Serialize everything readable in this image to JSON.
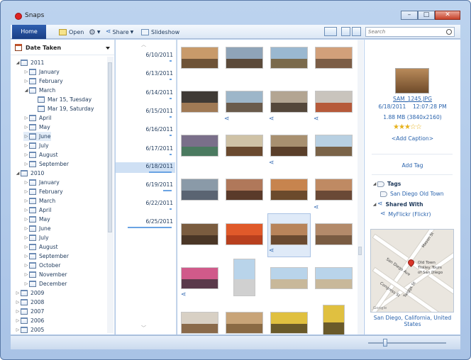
{
  "window": {
    "title": "Snaps"
  },
  "toolbar": {
    "home_tab": "Home",
    "open_label": "Open",
    "share_label": "Share",
    "slideshow_label": "Slideshow",
    "search_placeholder": "Search"
  },
  "sidebar": {
    "header": "Date Taken",
    "items": [
      {
        "label": "2011",
        "level": 0,
        "expanded": true
      },
      {
        "label": "January",
        "level": 1
      },
      {
        "label": "February",
        "level": 1
      },
      {
        "label": "March",
        "level": 1,
        "expanded": true
      },
      {
        "label": "Mar 15, Tuesday",
        "level": 2
      },
      {
        "label": "Mar 19, Saturday",
        "level": 2
      },
      {
        "label": "April",
        "level": 1
      },
      {
        "label": "May",
        "level": 1
      },
      {
        "label": "June",
        "level": 1,
        "selected": true
      },
      {
        "label": "July",
        "level": 1
      },
      {
        "label": "August",
        "level": 1
      },
      {
        "label": "September",
        "level": 1
      },
      {
        "label": "2010",
        "level": 0,
        "expanded": true
      },
      {
        "label": "January",
        "level": 1
      },
      {
        "label": "February",
        "level": 1
      },
      {
        "label": "March",
        "level": 1
      },
      {
        "label": "April",
        "level": 1
      },
      {
        "label": "May",
        "level": 1
      },
      {
        "label": "June",
        "level": 1
      },
      {
        "label": "July",
        "level": 1
      },
      {
        "label": "August",
        "level": 1
      },
      {
        "label": "September",
        "level": 1
      },
      {
        "label": "October",
        "level": 1
      },
      {
        "label": "November",
        "level": 1
      },
      {
        "label": "December",
        "level": 1
      },
      {
        "label": "2009",
        "level": 0
      },
      {
        "label": "2008",
        "level": 0
      },
      {
        "label": "2007",
        "level": 0
      },
      {
        "label": "2006",
        "level": 0
      },
      {
        "label": "2005",
        "level": 0
      }
    ]
  },
  "timeline": {
    "dates": [
      "6/10/2011",
      "6/13/2011",
      "6/14/2011",
      "6/15/2011",
      "6/16/2011",
      "6/17/2011",
      "6/18/2011",
      "6/19/2011",
      "6/22/2011",
      "6/25/2011"
    ],
    "selected": "6/18/2011"
  },
  "details": {
    "filename": "SAM_1245.JPG",
    "date": "6/18/2011",
    "time": "12:07:28 PM",
    "size": "1.88 MB (3840x2160)",
    "rating": 3,
    "rating_max": 5,
    "add_caption": "<Add Caption>",
    "add_tag": "Add Tag",
    "tags_header": "Tags",
    "tag_value": "San Diego Old Town",
    "shared_header": "Shared With",
    "shared_value": "MyFlickr (Flickr)",
    "map_location": "San Diego, California, United States"
  },
  "map": {
    "labels": [
      "Old Town",
      "Trolley Tours",
      "of San Diego",
      "Mason St",
      "San Diego Ave",
      "Congress St",
      "Twiggs St",
      "Google"
    ]
  },
  "colors": {
    "accent": "#2862ac",
    "selection": "#cfe0f4",
    "home_tab": "#1a3f85"
  }
}
